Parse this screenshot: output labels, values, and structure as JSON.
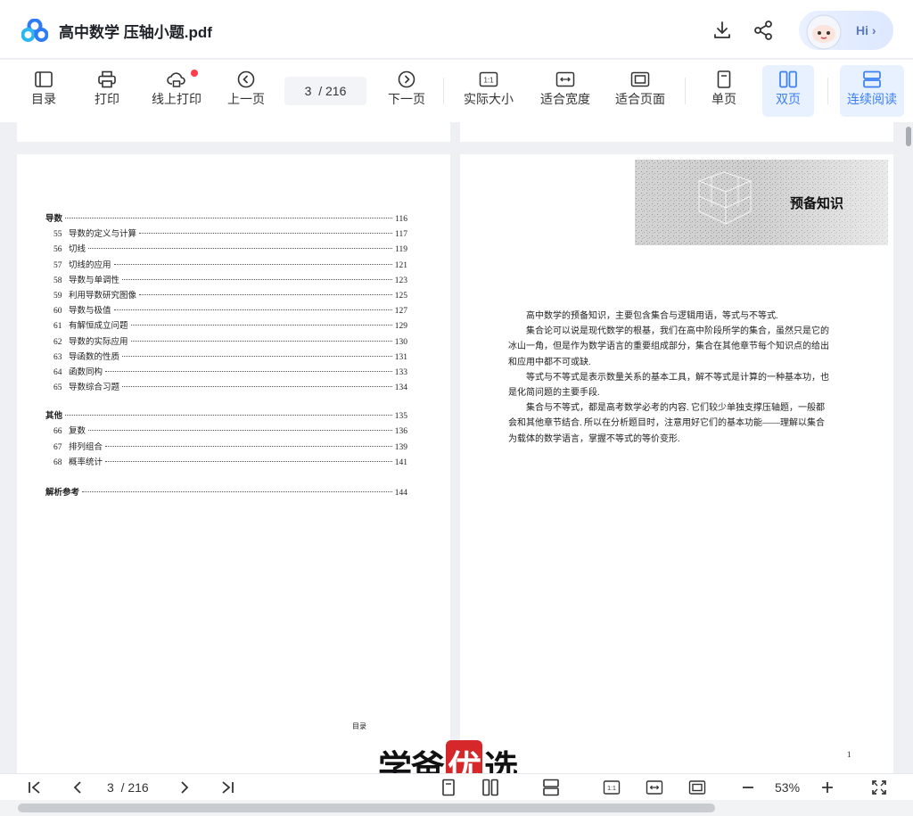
{
  "app": {
    "title": "高中数学 压轴小题.pdf",
    "assistant_label": "Hi"
  },
  "toolbar": {
    "toc": "目录",
    "print": "打印",
    "online_print": "线上打印",
    "prev": "上一页",
    "page_current": "3",
    "page_total": "/ 216",
    "next": "下一页",
    "actual_size": "实际大小",
    "fit_width": "适合宽度",
    "fit_page": "适合页面",
    "single": "单页",
    "double": "双页",
    "continuous": "连续阅读"
  },
  "toc": [
    {
      "type": "sec",
      "num": "",
      "title": "导数",
      "page": "116"
    },
    {
      "type": "item",
      "num": "55",
      "title": "导数的定义与计算",
      "page": "117"
    },
    {
      "type": "item",
      "num": "56",
      "title": "切线",
      "page": "119"
    },
    {
      "type": "item",
      "num": "57",
      "title": "切线的应用",
      "page": "121"
    },
    {
      "type": "item",
      "num": "58",
      "title": "导数与单调性",
      "page": "123"
    },
    {
      "type": "item",
      "num": "59",
      "title": "利用导数研究图像",
      "page": "125"
    },
    {
      "type": "item",
      "num": "60",
      "title": "导数与极值",
      "page": "127"
    },
    {
      "type": "item",
      "num": "61",
      "title": "有解恒成立问题",
      "page": "129"
    },
    {
      "type": "item",
      "num": "62",
      "title": "导数的实际应用",
      "page": "130"
    },
    {
      "type": "item",
      "num": "63",
      "title": "导函数的性质",
      "page": "131"
    },
    {
      "type": "item",
      "num": "64",
      "title": "函数同构",
      "page": "133"
    },
    {
      "type": "item",
      "num": "65",
      "title": "导数综合习题",
      "page": "134"
    },
    {
      "type": "sec",
      "num": "",
      "title": "其他",
      "page": "135"
    },
    {
      "type": "item",
      "num": "66",
      "title": "复数",
      "page": "136"
    },
    {
      "type": "item",
      "num": "67",
      "title": "排列组合",
      "page": "139"
    },
    {
      "type": "item",
      "num": "68",
      "title": "概率统计",
      "page": "141"
    },
    {
      "type": "sec",
      "num": "",
      "title": "解析参考",
      "page": "144"
    }
  ],
  "right_page": {
    "banner_title": "预备知识",
    "paragraphs": [
      "高中数学的预备知识，主要包含集合与逻辑用语，等式与不等式.",
      "集合论可以说是现代数学的根基，我们在高中阶段所学的集合，虽然只是它的冰山一角，但是作为数学语言的重要组成部分，集合在其他章节每个知识点的给出和应用中都不可或缺.",
      "等式与不等式是表示数量关系的基本工具，解不等式是计算的一种基本功，也是化简问题的主要手段.",
      "集合与不等式，都是高考数学必考的内容. 它们较少单独支撑压轴题，一般都会和其他章节结合. 所以在分析题目时，注意用好它们的基本功能——理解以集合为载体的数学语言，掌握不等式的等价变形."
    ],
    "page_number": "1",
    "footer_label": "目录"
  },
  "watermark": {
    "left": "学爸",
    "mid": "优",
    "right": "选"
  },
  "bottombar": {
    "page_current": "3",
    "page_total": "/ 216",
    "zoom": "53%"
  },
  "colors": {
    "accent": "#3b7ef7",
    "active_bg": "#e8f1ff",
    "dot": "#ff3b4c"
  }
}
